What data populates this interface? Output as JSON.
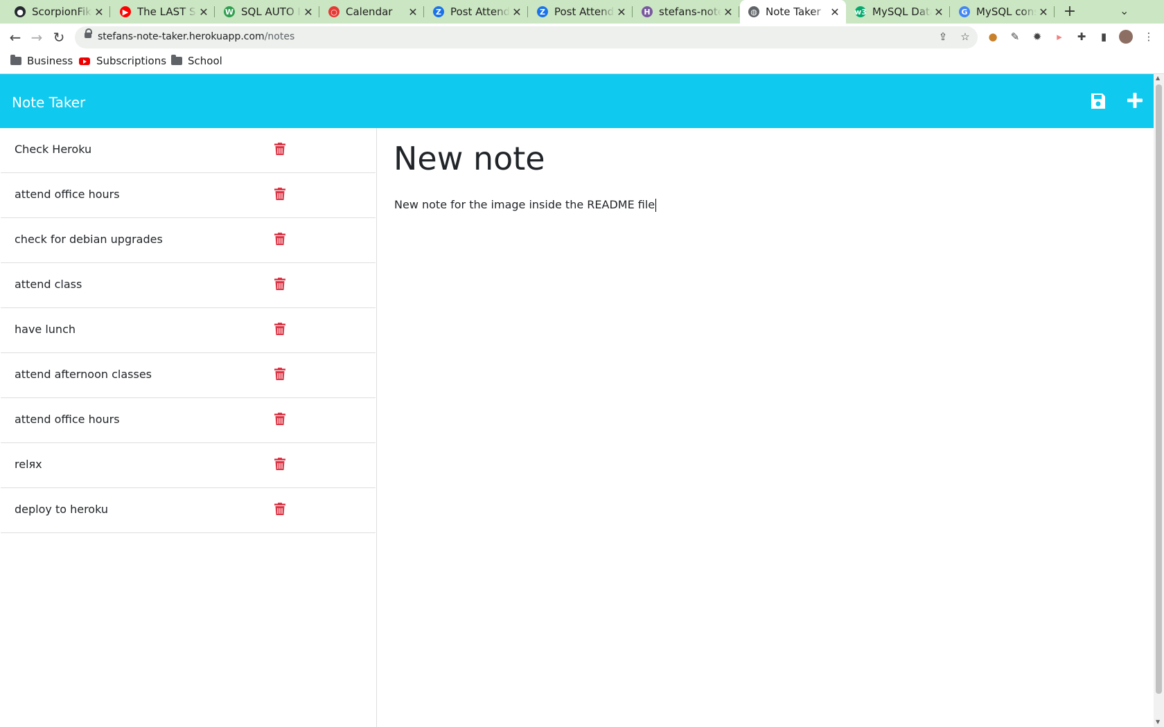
{
  "browser": {
    "tabs": [
      {
        "title": "ScorpionFiko",
        "icon": "github-icon",
        "color": "#24292f"
      },
      {
        "title": "The LAST So",
        "icon": "youtube-icon",
        "color": "#ff0000"
      },
      {
        "title": "SQL AUTO IN",
        "icon": "w-icon",
        "color": "#2e9e4f"
      },
      {
        "title": "Calendar",
        "icon": "calendar-icon",
        "color": "#e53935"
      },
      {
        "title": "Post Attende",
        "icon": "zoom-icon",
        "color": "#1a73e8"
      },
      {
        "title": "Post Attende",
        "icon": "zoom-icon",
        "color": "#1a73e8"
      },
      {
        "title": "stefans-note",
        "icon": "heroku-icon",
        "color": "#79589f"
      },
      {
        "title": "Note Taker",
        "icon": "globe-icon",
        "color": "#5f6368"
      },
      {
        "title": "MySQL Data",
        "icon": "w3schools-icon",
        "color": "#04aa6d"
      },
      {
        "title": "MySQL const",
        "icon": "google-icon",
        "color": "#4285f4"
      }
    ],
    "active_tab": "Note Taker",
    "url_host": "stefans-note-taker.herokuapp.com",
    "url_path": "/notes",
    "bookmarks": [
      {
        "label": "Business",
        "icon": "folder-icon"
      },
      {
        "label": "Subscriptions",
        "icon": "youtube-icon"
      },
      {
        "label": "School",
        "icon": "folder-icon"
      }
    ]
  },
  "app": {
    "title": "Note Taker",
    "header_color": "#10c9ef",
    "accent_color": "#dc3545",
    "notes": [
      {
        "title": "Check Heroku"
      },
      {
        "title": "attend office hours"
      },
      {
        "title": "check for debian upgrades"
      },
      {
        "title": "attend class"
      },
      {
        "title": "have lunch"
      },
      {
        "title": "attend afternoon classes"
      },
      {
        "title": "attend office hours"
      },
      {
        "title": "relяx"
      },
      {
        "title": "deploy to heroku"
      }
    ],
    "editor": {
      "title": "New note",
      "body": "New note for the image inside the README file"
    }
  }
}
